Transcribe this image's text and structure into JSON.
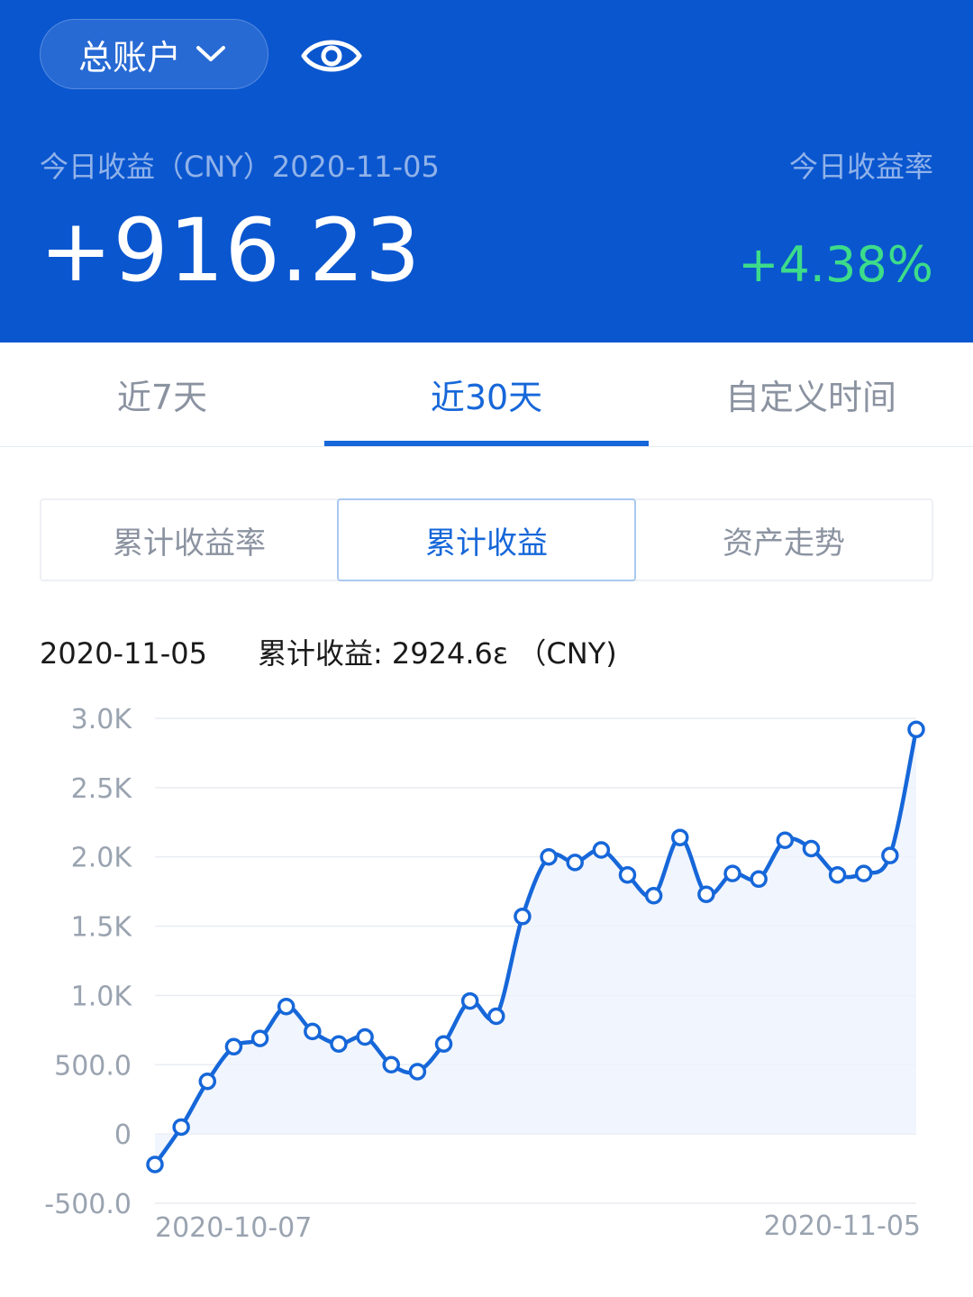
{
  "header": {
    "account_label": "总账户",
    "account_icon": "chevron-down-icon",
    "visibility_icon": "eye-icon",
    "today_label": "今日收益（CNY）2020-11-05",
    "today_value": "+916.23",
    "rate_label": "今日收益率",
    "today_rate": "+4.38%",
    "colors": {
      "header_bg": "#0a56cf",
      "positive": "#3ddc8a"
    }
  },
  "tabs": [
    {
      "label": "近7天",
      "active": false
    },
    {
      "label": "近30天",
      "active": true
    },
    {
      "label": "自定义时间",
      "active": false
    }
  ],
  "segments": [
    {
      "label": "累计收益率",
      "active": false
    },
    {
      "label": "累计收益",
      "active": true
    },
    {
      "label": "资产走势",
      "active": false
    }
  ],
  "info": {
    "date": "2020-11-05",
    "value_text": "累计收益: 2924.6ε （CNY)"
  },
  "chart_data": {
    "type": "line",
    "accent": "#1667d9",
    "ylim": [
      -500,
      3000
    ],
    "y_ticks": [
      "-500.0",
      "0",
      "500.0",
      "1.0K",
      "1.5K",
      "2.0K",
      "2.5K",
      "3.0K"
    ],
    "x_tick_labels": [
      "2020-10-07",
      "2020-11-05"
    ],
    "grid": true,
    "area_fill": true,
    "values": [
      -220,
      50,
      380,
      630,
      690,
      920,
      740,
      650,
      700,
      500,
      450,
      650,
      960,
      850,
      1570,
      2000,
      1960,
      2050,
      1870,
      1720,
      2140,
      1730,
      1880,
      1840,
      2120,
      2060,
      1870,
      1880,
      2010,
      2920
    ]
  }
}
